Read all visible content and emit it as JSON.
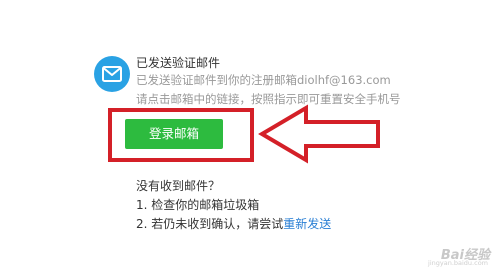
{
  "notice": {
    "title": "已发送验证邮件",
    "description": "已发送验证邮件到你的注册邮箱diolhf@163.com",
    "hint": "请点击邮箱中的链接，按照指示即可重置安全手机号"
  },
  "actions": {
    "login_mailbox_label": "登录邮箱"
  },
  "help": {
    "heading": "没有收到邮件？",
    "step_one": "1. 检查你的邮箱垃圾箱",
    "step_two_prefix": "2. 若仍未收到确认，请尝试",
    "resend_label": "重新发送"
  },
  "watermark": {
    "brand": "Bai经验",
    "url": "jingyan.baidu.com"
  },
  "colors": {
    "accent_blue": "#2aa2e4",
    "button_green": "#2dbb3f",
    "annotation_red": "#d42028",
    "link_blue": "#2a7fd4"
  },
  "icons": {
    "mail": "mail-icon",
    "annotation_arrow": "arrow-left-icon"
  }
}
